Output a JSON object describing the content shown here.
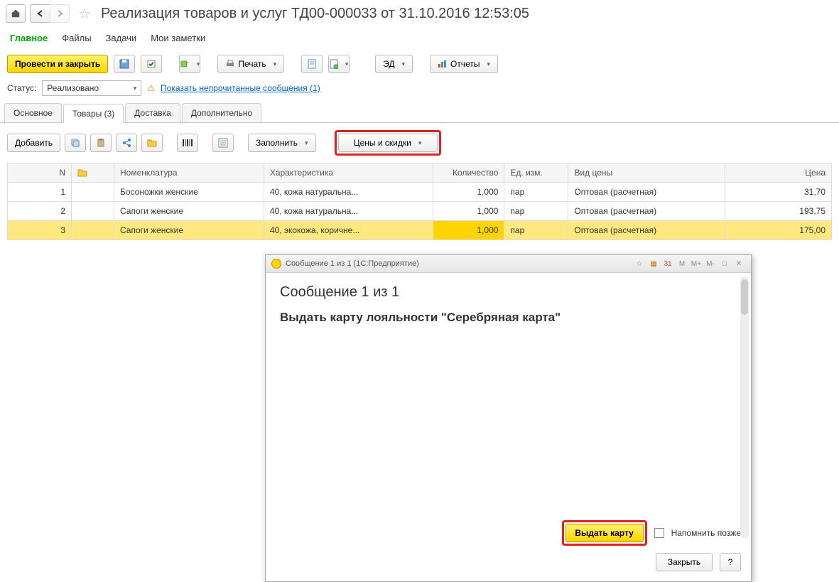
{
  "header": {
    "title": "Реализация товаров и услуг ТД00-000033 от 31.10.2016 12:53:05"
  },
  "mainTabs": {
    "t0": "Главное",
    "t1": "Файлы",
    "t2": "Задачи",
    "t3": "Мои заметки"
  },
  "toolbar": {
    "save_close": "Провести и закрыть",
    "print": "Печать",
    "edo": "ЭД",
    "reports": "Отчеты"
  },
  "status": {
    "label": "Статус:",
    "value": "Реализовано",
    "unread_link": "Показать непрочитанные сообщения (1)"
  },
  "subTabs": {
    "t0": "Основное",
    "t1": "Товары (3)",
    "t2": "Доставка",
    "t3": "Дополнительно"
  },
  "toolbar2": {
    "add": "Добавить",
    "fill": "Заполнить",
    "prices": "Цены и скидки"
  },
  "grid": {
    "cols": {
      "n": "N",
      "nomen": "Номенклатура",
      "char": "Характеристика",
      "qty": "Количество",
      "unit": "Ед. изм.",
      "ptype": "Вид цены",
      "price": "Цена"
    },
    "rows": [
      {
        "n": "1",
        "nomen": "Босоножки женские",
        "char": "40, кожа натуральна...",
        "qty": "1,000",
        "unit": "пар",
        "ptype": "Оптовая (расчетная)",
        "price": "31,70"
      },
      {
        "n": "2",
        "nomen": "Сапоги женские",
        "char": "40, кожа натуральна...",
        "qty": "1,000",
        "unit": "пар",
        "ptype": "Оптовая (расчетная)",
        "price": "193,75"
      },
      {
        "n": "3",
        "nomen": "Сапоги женские",
        "char": "40, экокожа, коричне...",
        "qty": "1,000",
        "unit": "пар",
        "ptype": "Оптовая (расчетная)",
        "price": "175,00"
      }
    ]
  },
  "dialog": {
    "titlebar": "Сообщение 1 из 1  (1С:Предприятие)",
    "heading": "Сообщение 1 из 1",
    "message": "Выдать карту лояльности \"Серебряная карта\"",
    "issue_btn": "Выдать карту",
    "remind": "Напомнить позже",
    "close": "Закрыть",
    "help": "?",
    "tb": {
      "m": "M",
      "mplus": "M+",
      "mminus": "M-"
    }
  }
}
